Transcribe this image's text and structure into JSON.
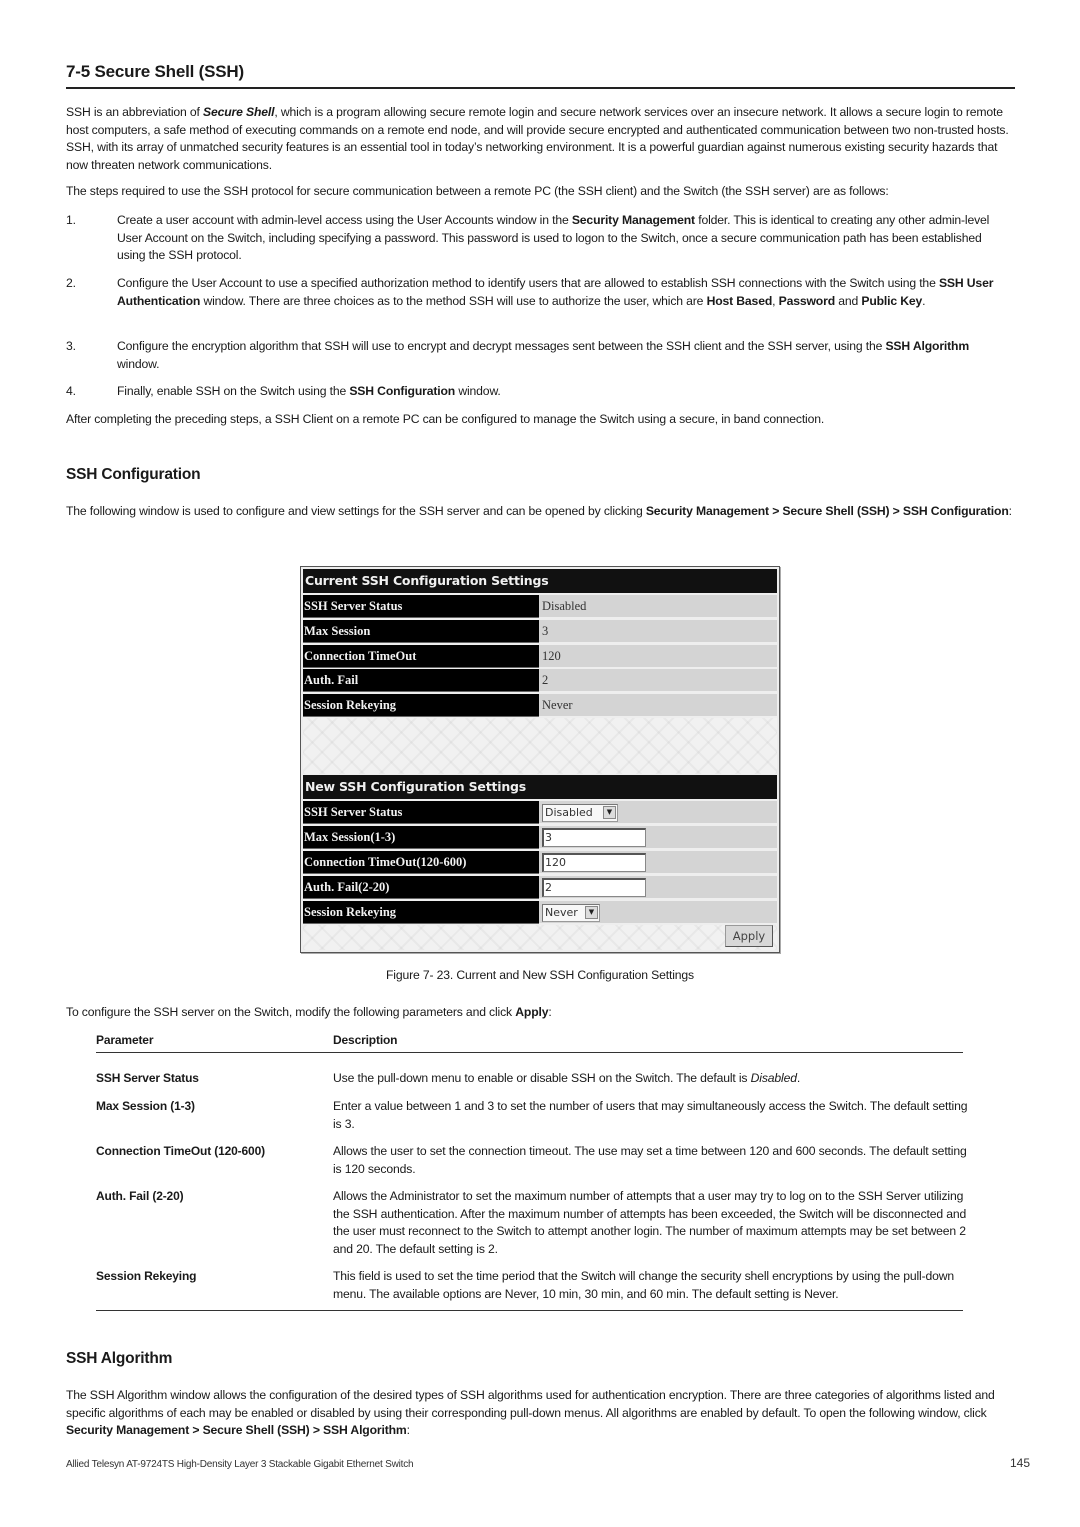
{
  "section": {
    "title": "7-5 Secure Shell (SSH)",
    "intro": {
      "pre": "SSH is an abbreviation of ",
      "bold_italic": "Secure Shell",
      "post": ", which is a program allowing secure remote login and secure network services over an insecure network. It allows a secure login to remote host computers, a safe method of executing commands on a remote end node, and will provide secure encrypted and authenticated communication between two non-trusted hosts. SSH, with its array of unmatched security features is an essential tool in today’s networking environment. It is a powerful guardian against numerous existing security hazards that now threaten network communications."
    },
    "steps_intro": "The steps required to use the SSH protocol for secure communication between a remote PC (the SSH client) and the Switch (the SSH server) are as follows:",
    "steps": [
      {
        "num": "1.",
        "t1": "Create a user account with admin-level access using the User Accounts window in the ",
        "b1": "Security Management",
        "t2": " folder. This is identical to creating any other admin-level User Account on the Switch, including specifying a password. This password is used to logon to the Switch, once a secure communication path has been established using the SSH protocol."
      },
      {
        "num": "2.",
        "t1": "Configure the User Account to use a specified authorization method to identify users that are allowed to establish SSH connections with the Switch using the ",
        "b1": "SSH User Authentication",
        "t2": " window. There are three choices as to the method SSH will use to authorize the user, which are ",
        "b2": "Host Based",
        "t3": ", ",
        "b3": "Password",
        "t4": " and ",
        "b4": "Public Key",
        "t5": "."
      },
      {
        "num": "3.",
        "t1": "Configure the encryption algorithm that SSH will use to encrypt and decrypt messages sent between the SSH client and the SSH server, using the ",
        "b1": "SSH Algorithm",
        "t2": " window."
      },
      {
        "num": "4.",
        "t1": "Finally, enable SSH on the Switch using the ",
        "b1": "SSH Configuration",
        "t2": " window."
      }
    ],
    "after": "After completing the preceding steps, a SSH Client on a remote PC can be configured to manage the Switch using a secure, in band connection."
  },
  "ssh_config": {
    "heading": "SSH Configuration",
    "para_pre": "The following window is used to configure and view settings for the SSH server and can be opened by clicking ",
    "para_bold": "Security Management > Secure Shell (SSH) > SSH Configuration",
    "para_post": ":",
    "panel": {
      "current_title": "Current SSH Configuration Settings",
      "current_rows": [
        {
          "label": "SSH Server Status",
          "value": "Disabled"
        },
        {
          "label": "Max Session",
          "value": "3"
        },
        {
          "label": "Connection TimeOut",
          "value": "120"
        },
        {
          "label": "Auth. Fail",
          "value": "2"
        },
        {
          "label": "Session Rekeying",
          "value": "Never"
        }
      ],
      "new_title": "New SSH Configuration Settings",
      "new_rows": [
        {
          "label": "SSH Server Status",
          "value": "Disabled",
          "control": "select"
        },
        {
          "label": "Max Session(1-3)",
          "value": "3",
          "control": "input"
        },
        {
          "label": "Connection TimeOut(120-600)",
          "value": "120",
          "control": "input"
        },
        {
          "label": "Auth. Fail(2-20)",
          "value": "2",
          "control": "input"
        },
        {
          "label": "Session Rekeying",
          "value": "Never",
          "control": "select"
        }
      ],
      "apply_label": "Apply",
      "dropdown_arrow": "▼"
    },
    "figure_caption": "Figure 7- 23. Current and New SSH Configuration Settings",
    "apply_para_pre": "To configure the SSH server on the Switch, modify the following parameters and click ",
    "apply_para_bold": "Apply",
    "apply_para_post": ":",
    "table": {
      "headers": [
        "Parameter",
        "Description"
      ],
      "rows": [
        {
          "param": "SSH Server Status",
          "desc": "Use the pull-down menu to enable or disable SSH on the Switch. The default is ",
          "desc_italic": "Disabled",
          "desc_post": "."
        },
        {
          "param": "Max Session (1-3)",
          "desc": "Enter a value between 1 and 3 to set the number of users that may simultaneously access the Switch. The default setting is 3."
        },
        {
          "param": "Connection TimeOut (120-600)",
          "desc": "Allows the user to set the connection timeout. The use may set a time between 120 and 600 seconds. The default setting is 120 seconds."
        },
        {
          "param": "Auth. Fail (2-20)",
          "desc": "Allows the Administrator to set the maximum number of attempts that a user may try to log on to the SSH Server utilizing the SSH authentication. After the maximum number of attempts has been exceeded, the Switch will be disconnected and the user must reconnect to the Switch to attempt another login. The number of maximum attempts may be set between 2 and 20. The default setting is 2."
        },
        {
          "param": "Session Rekeying",
          "desc": "This field is used to set the time period that the Switch will change the security shell encryptions by using the pull-down menu. The available options are Never, 10 min, 30 min, and 60 min. The default setting is Never."
        }
      ]
    }
  },
  "ssh_algorithm": {
    "heading": "SSH Algorithm",
    "para": "The SSH Algorithm window allows the configuration of the desired types of SSH algorithms used for authentication encryption. There are three categories of algorithms listed and specific algorithms of each may be enabled or disabled by using their corresponding pull-down menus. All algorithms are enabled by default. To open the following window, click ",
    "para_bold": "Security Management > Secure Shell (SSH) > SSH Algorithm",
    "para_post": ":"
  },
  "footer": {
    "text": "Allied Telesyn AT-9724TS High-Density Layer 3 Stackable Gigabit Ethernet Switch",
    "page_number": "145"
  }
}
